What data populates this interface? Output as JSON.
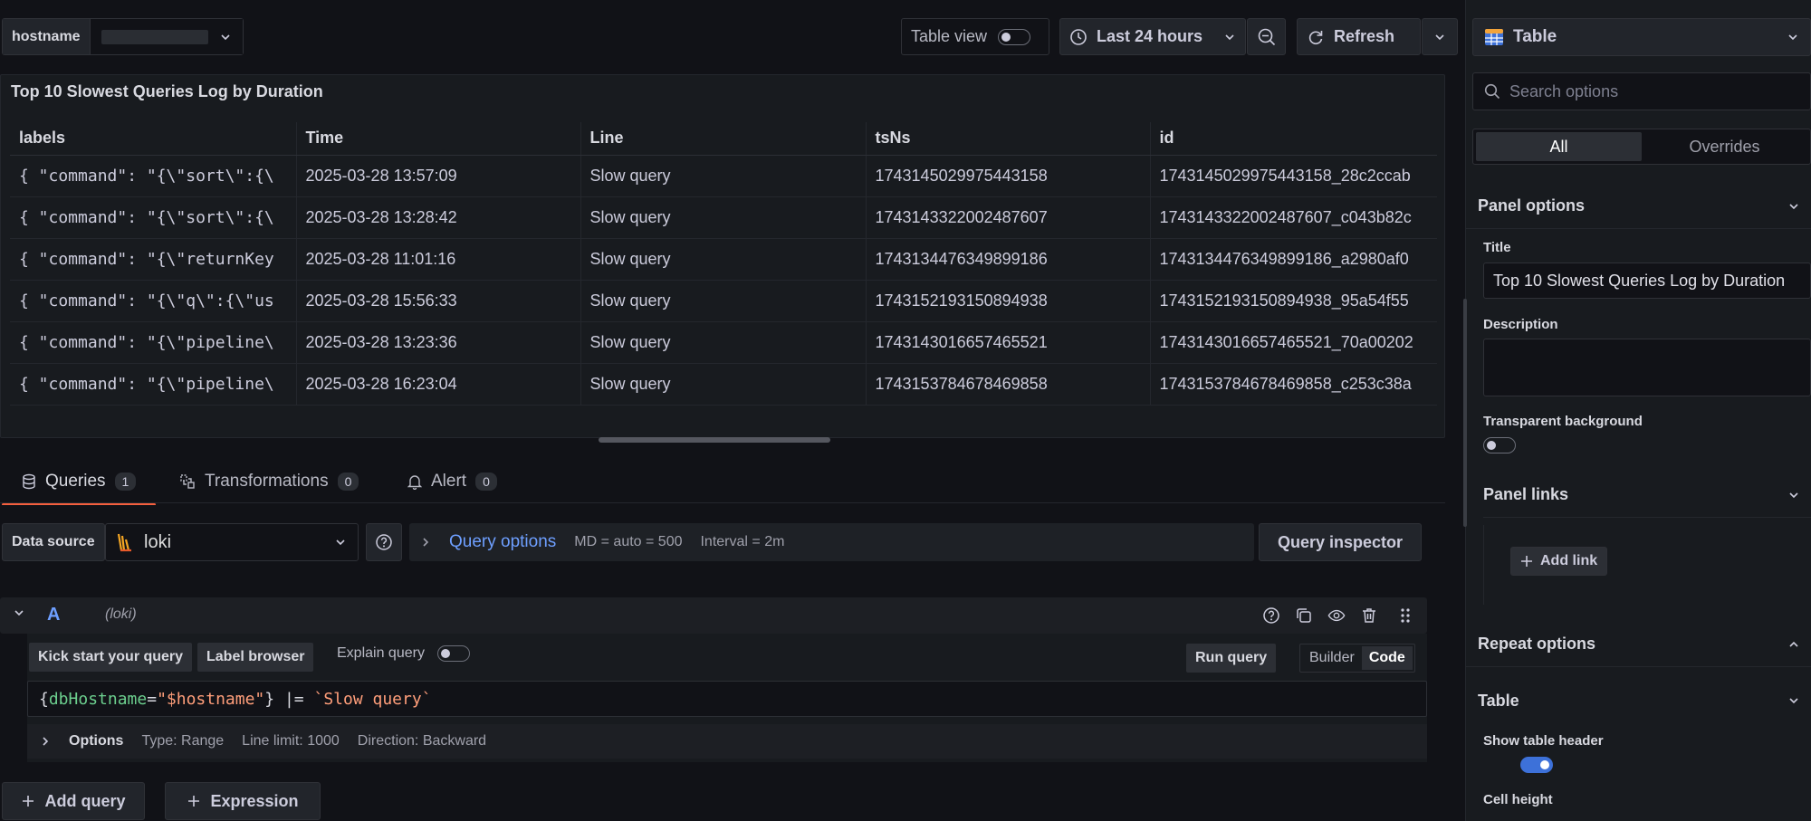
{
  "variables": {
    "hostname_label": "hostname",
    "hostname_value": ""
  },
  "toolbar": {
    "table_view_label": "Table view",
    "time_range_label": "Last 24 hours",
    "refresh_label": "Refresh"
  },
  "panel": {
    "title": "Top 10 Slowest Queries Log by Duration",
    "columns": [
      "labels",
      "Time",
      "Line",
      "tsNs",
      "id"
    ],
    "rows": [
      [
        "{ \"command\": \"{\\\"sort\\\":{\\",
        "2025-03-28 13:57:09",
        "Slow query",
        "1743145029975443158",
        "1743145029975443158_28c2ccab"
      ],
      [
        "{ \"command\": \"{\\\"sort\\\":{\\",
        "2025-03-28 13:28:42",
        "Slow query",
        "1743143322002487607",
        "1743143322002487607_c043b82c"
      ],
      [
        "{ \"command\": \"{\\\"returnKey",
        "2025-03-28 11:01:16",
        "Slow query",
        "1743134476349899186",
        "1743134476349899186_a2980af0"
      ],
      [
        "{ \"command\": \"{\\\"q\\\":{\\\"us",
        "2025-03-28 15:56:33",
        "Slow query",
        "1743152193150894938",
        "1743152193150894938_95a54f55"
      ],
      [
        "{ \"command\": \"{\\\"pipeline\\",
        "2025-03-28 13:23:36",
        "Slow query",
        "1743143016657465521",
        "1743143016657465521_70a00202"
      ],
      [
        "{ \"command\": \"{\\\"pipeline\\",
        "2025-03-28 16:23:04",
        "Slow query",
        "1743153784678469858",
        "1743153784678469858_c253c38a"
      ]
    ]
  },
  "tabs": [
    {
      "label": "Queries",
      "count": "1"
    },
    {
      "label": "Transformations",
      "count": "0"
    },
    {
      "label": "Alert",
      "count": "0"
    }
  ],
  "query": {
    "data_source_label": "Data source",
    "data_source_value": "loki",
    "query_options_label": "Query options",
    "md_label": "MD = auto = 500",
    "interval_label": "Interval = 2m",
    "inspector_label": "Query inspector",
    "ref_id": "A",
    "ref_ds": "(loki)",
    "kick_start_label": "Kick start your query",
    "label_browser_label": "Label browser",
    "explain_label": "Explain query",
    "run_query_label": "Run query",
    "builder_label": "Builder",
    "code_label": "Code",
    "code": {
      "open": "{",
      "key": "dbHostname",
      "eq": "=",
      "value": "\"$hostname\"",
      "close": "}",
      "pipe": " |= ",
      "filter": "`Slow query`"
    },
    "options_label": "Options",
    "type_label": "Type: Range",
    "line_limit_label": "Line limit: 1000",
    "direction_label": "Direction: Backward",
    "add_query_label": "Add query",
    "expression_label": "Expression"
  },
  "options_pane": {
    "viz_label": "Table",
    "search_placeholder": "Search options",
    "seg_all": "All",
    "seg_overrides": "Overrides",
    "panel_options_label": "Panel options",
    "title_label": "Title",
    "title_value": "Top 10 Slowest Queries Log by Duration",
    "description_label": "Description",
    "transparent_label": "Transparent background",
    "panel_links_label": "Panel links",
    "add_link_label": "Add link",
    "repeat_options_label": "Repeat options",
    "table_section_label": "Table",
    "show_header_label": "Show table header",
    "cell_height_label": "Cell height"
  },
  "colors": {
    "accent": "#6e9fff",
    "active_tab": "#f55f3e",
    "toggle_on": "#3d71d9"
  }
}
